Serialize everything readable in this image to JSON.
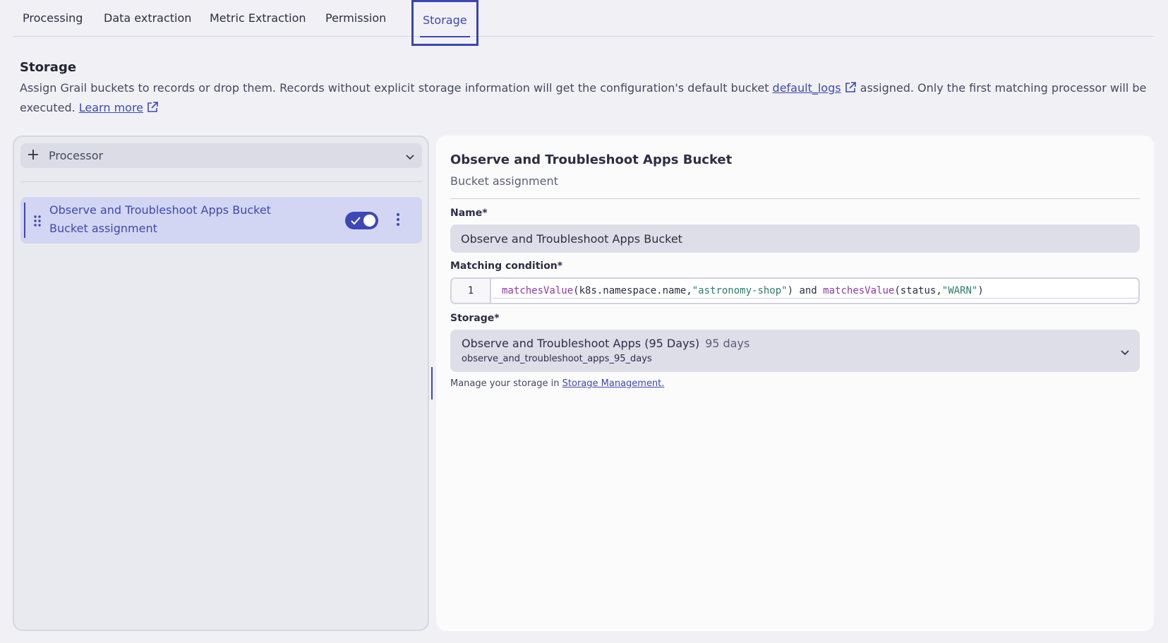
{
  "tabs": [
    {
      "label": "Processing"
    },
    {
      "label": "Data extraction"
    },
    {
      "label": "Metric Extraction"
    },
    {
      "label": "Permission"
    },
    {
      "label": "Storage"
    }
  ],
  "header": {
    "title": "Storage",
    "description_part1": "Assign Grail buckets to records or drop them. Records without explicit storage information will get the configuration's default bucket ",
    "default_bucket_link": "default_logs",
    "description_part2": " assigned. Only the first matching processor will be executed. ",
    "learn_more": "Learn more"
  },
  "left_panel": {
    "add_processor_label": "Processor",
    "processor_item": {
      "title": "Observe and Troubleshoot Apps Bucket",
      "subtitle": "Bucket assignment",
      "enabled": true
    }
  },
  "detail": {
    "title": "Observe and Troubleshoot Apps Bucket",
    "subtitle": "Bucket assignment",
    "name_label": "Name*",
    "name_value": "Observe and Troubleshoot Apps Bucket",
    "condition_label": "Matching condition*",
    "condition": {
      "line_number": "1",
      "fn1": "matchesValue",
      "arg1": "(k8s.namespace.name,",
      "str1": "\"astronomy-shop\"",
      "mid": ") and ",
      "fn2": "matchesValue",
      "arg2": "(status,",
      "str2": "\"WARN\"",
      "end": ")"
    },
    "storage_label": "Storage*",
    "storage_name": "Observe and Troubleshoot Apps (95 Days)",
    "storage_days": "95 days",
    "storage_bucket": "observe_and_troubleshoot_apps_95_days",
    "manage_text": "Manage your storage in ",
    "manage_link": "Storage Management."
  },
  "colors": {
    "accent": "#3d48b5",
    "background": "#f1f1f5",
    "selected_item": "#d3d6f2"
  }
}
